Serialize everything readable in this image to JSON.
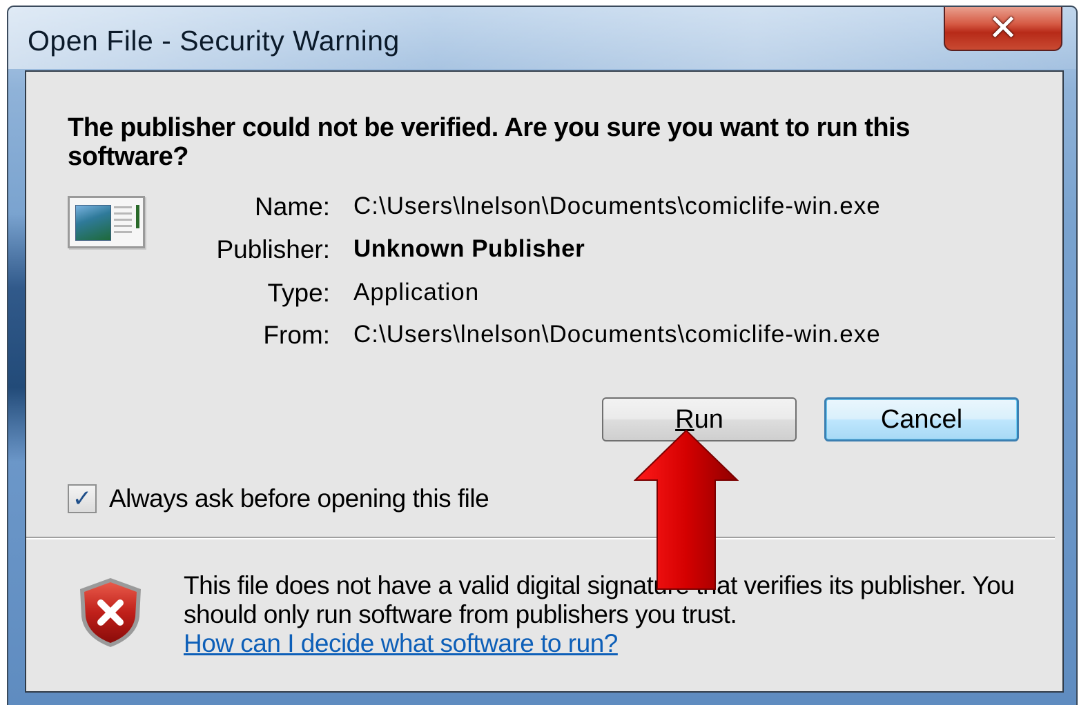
{
  "window": {
    "title": "Open File - Security Warning",
    "close_glyph": "✕",
    "accent_color": "#7aa3cf"
  },
  "dialog": {
    "heading": "The publisher could not be verified.  Are you sure you want to run this software?",
    "app_icon": "application-icon",
    "fields": [
      {
        "label": "Name:",
        "value": "C:\\Users\\lnelson\\Documents\\comiclife-win.exe"
      },
      {
        "label": "Publisher:",
        "value": "Unknown Publisher"
      },
      {
        "label": "Type:",
        "value": "Application"
      },
      {
        "label": "From:",
        "value": "C:\\Users\\lnelson\\Documents\\comiclife-win.exe"
      }
    ],
    "buttons": {
      "run": "Run",
      "cancel": "Cancel"
    },
    "checkbox": {
      "label": "Always ask before opening this file",
      "checked": true
    },
    "warning": {
      "icon": "shield-error-icon",
      "text": "This file does not have a valid digital signature that verifies its publisher.  You should only run software from publishers you trust.",
      "link": "How can I decide what software to run?"
    }
  },
  "annotation": {
    "icon": "red-arrow-up-icon",
    "color": "#d40000"
  }
}
